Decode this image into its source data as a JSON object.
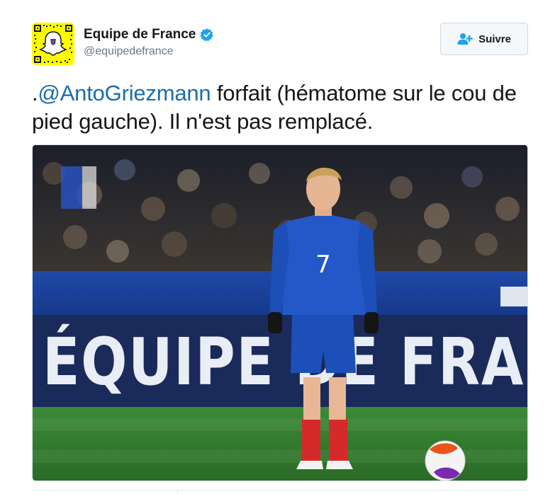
{
  "tweet": {
    "author_name": "Equipe de France",
    "author_handle": "@equipedefrance",
    "follow_label": "Suivre",
    "text_prefix": ".",
    "mention": "@AntoGriezmann",
    "text_rest": " forfait (hématome sur le cou de pied gauche). Il n'est pas remplacé."
  },
  "media": {
    "banner_text": "ÉQUIPE DE FRA",
    "jersey_number": "7"
  },
  "icons": {
    "avatar": "snapchat-ghost-icon",
    "verified": "verified-badge-icon",
    "follow": "add-user-icon"
  },
  "colors": {
    "avatar_bg": "#fffc00",
    "verified": "#1da1f2",
    "mention": "#1b6dac",
    "jersey": "#1d4fb8",
    "pitch": "#2f7a2c",
    "banner": "#1a3a8c"
  }
}
